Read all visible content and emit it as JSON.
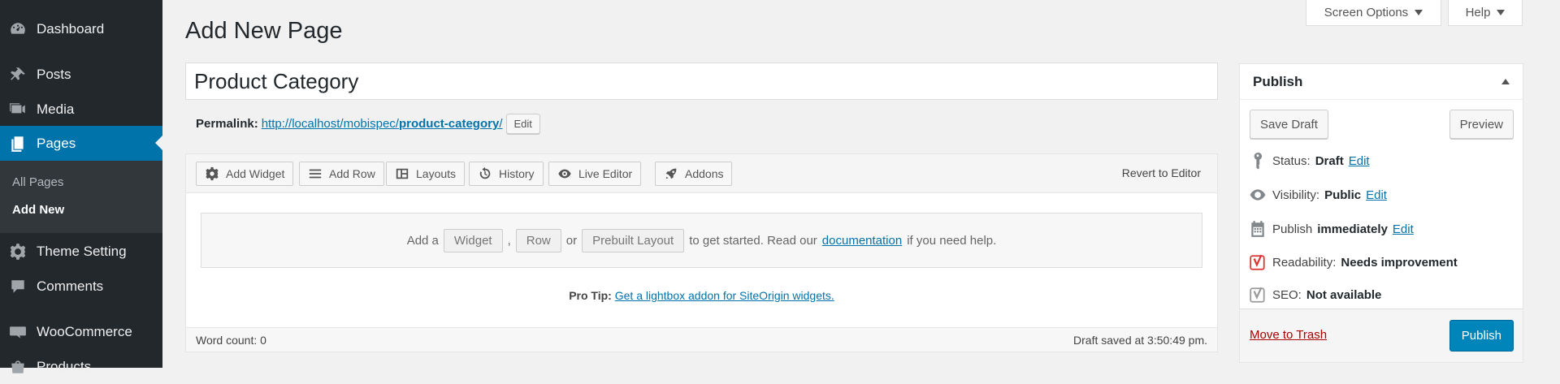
{
  "sidebar": {
    "items": [
      {
        "label": "Dashboard",
        "icon": "dashboard-icon"
      },
      {
        "label": "Posts",
        "icon": "pin-icon"
      },
      {
        "label": "Media",
        "icon": "media-icon"
      },
      {
        "label": "Pages",
        "icon": "pages-icon"
      },
      {
        "label": "Theme Setting",
        "icon": "gear-icon"
      },
      {
        "label": "Comments",
        "icon": "comment-icon"
      },
      {
        "label": "WooCommerce",
        "icon": "woocommerce-icon"
      },
      {
        "label": "Products",
        "icon": "products-icon"
      }
    ],
    "submenu": [
      "All Pages",
      "Add New"
    ]
  },
  "header": {
    "title": "Add New Page",
    "screen_options": "Screen Options",
    "help": "Help"
  },
  "editor": {
    "title_value": "Product Category",
    "permalink_label": "Permalink:",
    "permalink_base": "http://localhost/mobispec/",
    "permalink_slug": "product-category",
    "permalink_trail": "/",
    "permalink_edit": "Edit"
  },
  "builder": {
    "toolbar": [
      "Add Widget",
      "Add Row",
      "Layouts",
      "History",
      "Live Editor",
      "Addons"
    ],
    "revert": "Revert to Editor",
    "empty": {
      "prefix": "Add a",
      "widget": "Widget",
      "comma": ",",
      "row": "Row",
      "or": "or",
      "prebuilt": "Prebuilt Layout",
      "middle": "to get started. Read our",
      "doc_link": "documentation",
      "suffix": "if you need help."
    },
    "protip_label": "Pro Tip:",
    "protip_link": "Get a lightbox addon for SiteOrigin widgets.",
    "word_count": "Word count: 0",
    "draft_saved": "Draft saved at 3:50:49 pm."
  },
  "publish": {
    "title": "Publish",
    "save_draft": "Save Draft",
    "preview": "Preview",
    "status_label": "Status:",
    "status_value": "Draft",
    "visibility_label": "Visibility:",
    "visibility_value": "Public",
    "publish_label": "Publish",
    "publish_value": "immediately",
    "edit": "Edit",
    "readability_label": "Readability:",
    "readability_value": "Needs improvement",
    "seo_label": "SEO:",
    "seo_value": "Not available",
    "trash": "Move to Trash",
    "publish_button": "Publish"
  },
  "colors": {
    "sidebar_bg": "#23282d",
    "active_bg": "#0073aa",
    "primary_button": "#0085ba",
    "trash": "#a00000",
    "readability_red": "#dc3232"
  }
}
